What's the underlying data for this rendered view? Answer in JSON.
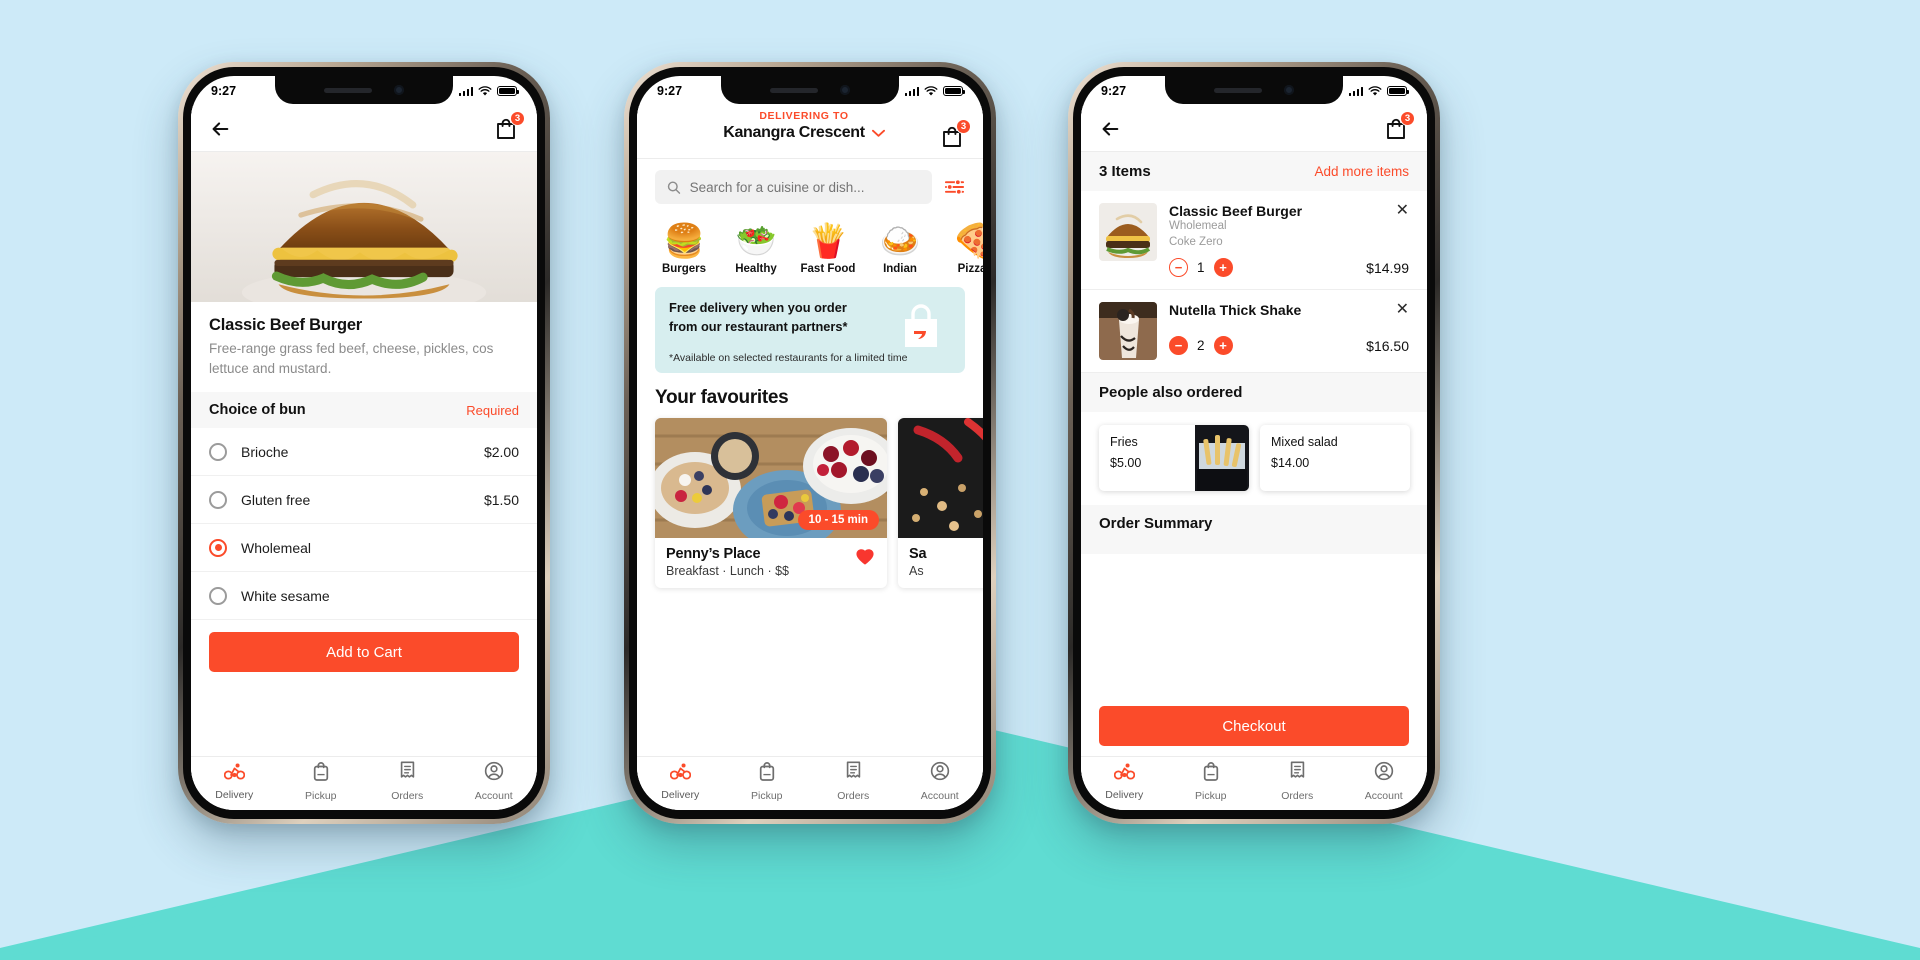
{
  "theme": {
    "accent": "#fb4b2a",
    "bg_top": "#cdeaf8",
    "bg_bottom": "#5fdcd2",
    "promo_bg": "#d7eeef"
  },
  "status_bar": {
    "time": "9:27"
  },
  "phone1": {
    "nav": {
      "back_icon": "arrow-left-icon",
      "bag_icon": "shopping-bag-icon",
      "bag_count": "3"
    },
    "item": {
      "title": "Classic Beef Burger",
      "description": "Free-range grass fed beef, cheese, pickles, cos lettuce and mustard."
    },
    "section": {
      "title": "Choice of bun",
      "required": "Required"
    },
    "options": [
      {
        "label": "Brioche",
        "price": "$2.00",
        "selected": false
      },
      {
        "label": "Gluten free",
        "price": "$1.50",
        "selected": false
      },
      {
        "label": "Wholemeal",
        "price": "",
        "selected": true
      },
      {
        "label": "White sesame",
        "price": "",
        "selected": false
      }
    ],
    "cta": "Add to Cart"
  },
  "phone2": {
    "header": {
      "delivering_to": "DELIVERING TO",
      "address": "Kanangra Crescent",
      "chevron_icon": "chevron-down-icon",
      "bag_count": "3"
    },
    "search": {
      "placeholder": "Search for a cuisine or dish...",
      "value": "",
      "icon": "search-icon",
      "filter_icon": "filter-sliders-icon"
    },
    "categories": [
      {
        "label": "Burgers",
        "glyph": "🍔"
      },
      {
        "label": "Healthy",
        "glyph": "🥗"
      },
      {
        "label": "Fast Food",
        "glyph": "🍟"
      },
      {
        "label": "Indian",
        "glyph": "🍛"
      },
      {
        "label": "Pizza",
        "glyph": "🍕"
      }
    ],
    "promo": {
      "line1": "Free delivery when you order from our restaurant partners*",
      "note": "*Available on selected restaurants for a limited time",
      "icon": "delivery-bag-icon"
    },
    "favourites_title": "Your favourites",
    "restaurants": [
      {
        "name": "Penny’s Place",
        "subtitle": "Breakfast · Lunch · $$",
        "eta": "10 - 15 min",
        "favourite": true
      },
      {
        "name": "Sa",
        "subtitle": "As",
        "eta": "",
        "favourite": false
      }
    ]
  },
  "phone3": {
    "nav": {
      "back_icon": "arrow-left-icon",
      "bag_icon": "shopping-bag-icon",
      "bag_count": "3"
    },
    "cart_header": {
      "count": "3 Items",
      "add_more": "Add more items"
    },
    "items": [
      {
        "name": "Classic Beef Burger",
        "options": [
          "Wholemeal",
          "Coke Zero"
        ],
        "qty": "1",
        "price": "$14.99",
        "minus_filled": false
      },
      {
        "name": "Nutella Thick Shake",
        "options": [],
        "qty": "2",
        "price": "$16.50",
        "minus_filled": true
      }
    ],
    "also_ordered_title": "People also ordered",
    "also_ordered": [
      {
        "name": "Fries",
        "price": "$5.00"
      },
      {
        "name": "Mixed salad",
        "price": "$14.00"
      }
    ],
    "order_summary_title": "Order Summary",
    "checkout": "Checkout"
  },
  "tabbar": [
    {
      "label": "Delivery",
      "icon": "bicycle-icon",
      "active": true
    },
    {
      "label": "Pickup",
      "icon": "bag-icon",
      "active": false
    },
    {
      "label": "Orders",
      "icon": "receipt-icon",
      "active": false
    },
    {
      "label": "Account",
      "icon": "account-icon",
      "active": false
    }
  ]
}
